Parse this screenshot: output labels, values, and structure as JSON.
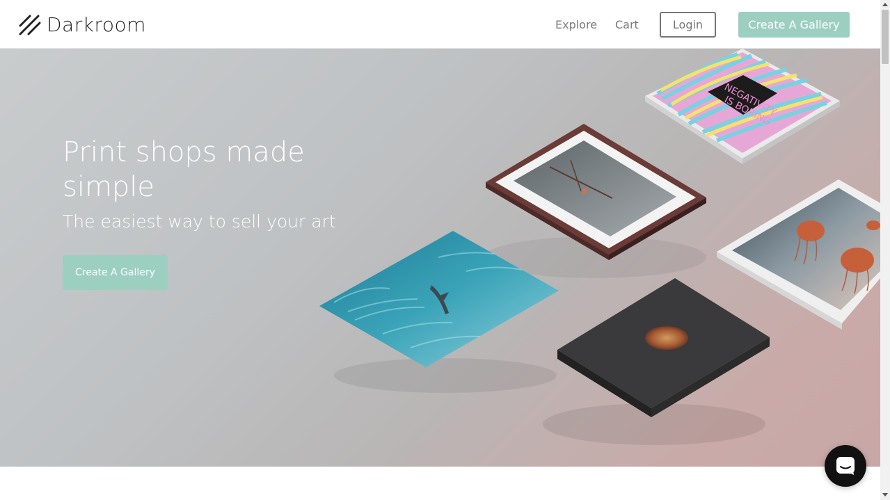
{
  "brand": {
    "name": "Darkroom",
    "logo_icon": "slash-lines-icon"
  },
  "nav": {
    "explore": "Explore",
    "cart": "Cart",
    "login": "Login",
    "create_gallery": "Create A Gallery"
  },
  "hero": {
    "title": "Print shops made simple",
    "subtitle": "The easiest way to sell your art",
    "cta": "Create A Gallery",
    "artwork_text": {
      "line1": "NEGATIVITY",
      "line2": "IS BORING"
    }
  },
  "chat": {
    "icon": "chat-bubble-icon"
  },
  "colors": {
    "accent": "#9ccfc0",
    "text_dark": "#222222",
    "nav_text": "#7a7a7a",
    "chat_bg": "#111111"
  }
}
